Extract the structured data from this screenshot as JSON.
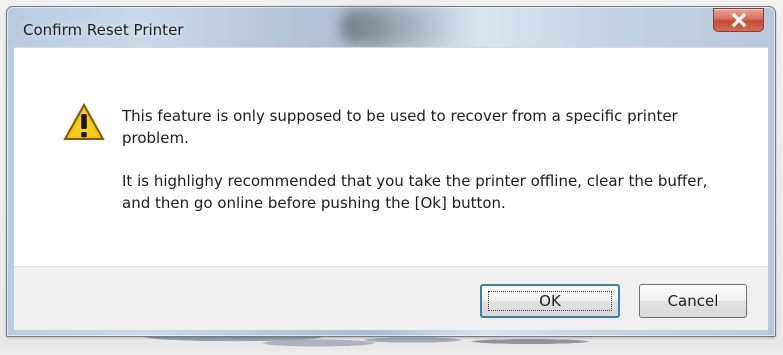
{
  "window": {
    "title": "Confirm Reset Printer"
  },
  "icons": {
    "close": "close-icon",
    "warning": "warning-icon"
  },
  "message": {
    "line1": "This feature is only supposed to be used to recover from a specific printer problem.",
    "line2": "It is highlighy recommended that you take the printer offline, clear the buffer, and then go online before pushing the [Ok] button."
  },
  "buttons": {
    "ok": "OK",
    "cancel": "Cancel"
  },
  "colors": {
    "titlebar": "#c9d9ea",
    "close_button": "#c44a36",
    "warning_fill": "#f5c400",
    "primary_button_border": "#3c7fb1"
  }
}
